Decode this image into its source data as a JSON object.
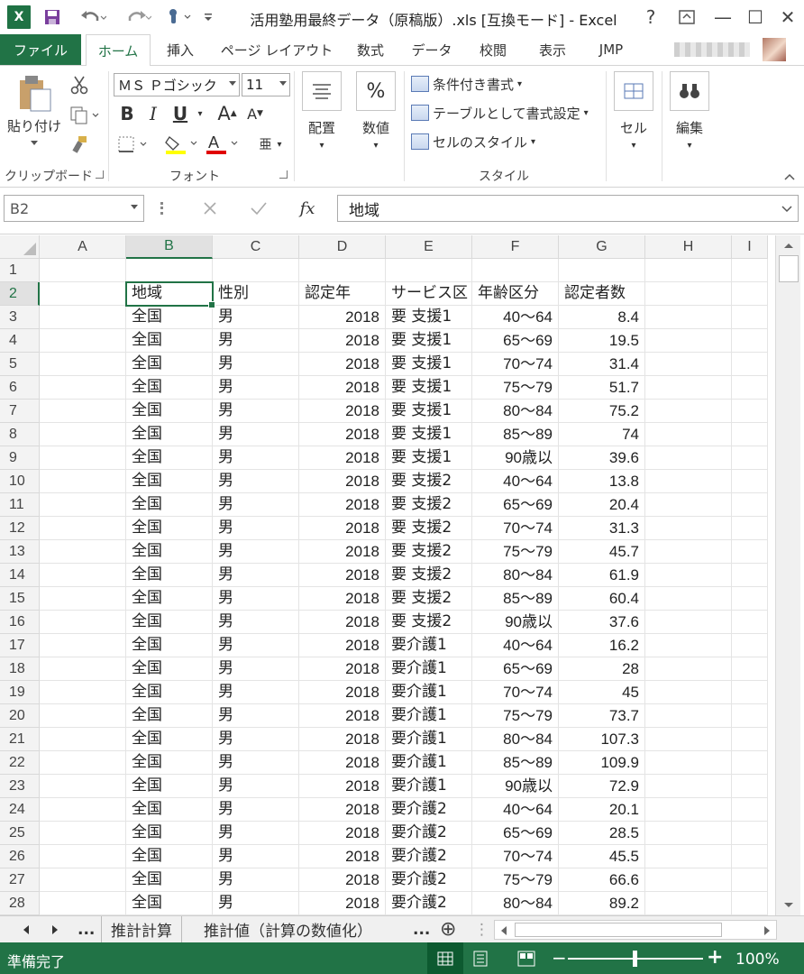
{
  "window": {
    "title": "活用塾用最終データ（原稿版）.xls  [互換モード] - Excel",
    "logo_text": "X",
    "help": "?",
    "controls": {
      "minimize": "—",
      "maximize": "☐",
      "close": "✕"
    }
  },
  "qat": {
    "save": "💾",
    "undo": "↶",
    "redo": "↷",
    "touch": "☝"
  },
  "tabs": {
    "file": "ファイル",
    "home": "ホーム",
    "insert": "挿入",
    "page_layout": "ページ レイアウト",
    "formulas": "数式",
    "data": "データ",
    "review": "校閲",
    "view": "表示",
    "jmp": "JMP"
  },
  "ribbon": {
    "clipboard": {
      "paste": "貼り付け",
      "label": "クリップボード"
    },
    "font": {
      "name": "ＭＳ Ｐゴシック",
      "size": "11",
      "bold": "B",
      "italic": "I",
      "underline": "U",
      "grow": "A",
      "shrink": "A",
      "label": "フォント",
      "furigana": "亜"
    },
    "alignment": {
      "label": "配置"
    },
    "number": {
      "label": "数値",
      "icon": "%"
    },
    "styles": {
      "conditional": "条件付き書式",
      "table": "テーブルとして書式設定",
      "cell_styles": "セルのスタイル",
      "label": "スタイル"
    },
    "cells": {
      "label": "セル"
    },
    "editing": {
      "label": "編集"
    }
  },
  "formula_bar": {
    "name_box": "B2",
    "fx": "fx",
    "value": "地域"
  },
  "columns": [
    "A",
    "B",
    "C",
    "D",
    "E",
    "F",
    "G",
    "H",
    "I"
  ],
  "rows": [
    {
      "n": "1",
      "b": "",
      "c": "",
      "d": "",
      "e": "",
      "f": "",
      "g": ""
    },
    {
      "n": "2",
      "b": "地域",
      "c": "性別",
      "d": "認定年",
      "e": "サービス区",
      "f": "年齢区分",
      "g": "認定者数"
    },
    {
      "n": "3",
      "b": "全国",
      "c": "男",
      "d": "2018",
      "e": "要 支援1",
      "f": "40〜64",
      "g": "8.4"
    },
    {
      "n": "4",
      "b": "全国",
      "c": "男",
      "d": "2018",
      "e": "要 支援1",
      "f": "65〜69",
      "g": "19.5"
    },
    {
      "n": "5",
      "b": "全国",
      "c": "男",
      "d": "2018",
      "e": "要 支援1",
      "f": "70〜74",
      "g": "31.4"
    },
    {
      "n": "6",
      "b": "全国",
      "c": "男",
      "d": "2018",
      "e": "要 支援1",
      "f": "75〜79",
      "g": "51.7"
    },
    {
      "n": "7",
      "b": "全国",
      "c": "男",
      "d": "2018",
      "e": "要 支援1",
      "f": "80〜84",
      "g": "75.2"
    },
    {
      "n": "8",
      "b": "全国",
      "c": "男",
      "d": "2018",
      "e": "要 支援1",
      "f": "85〜89",
      "g": "74"
    },
    {
      "n": "9",
      "b": "全国",
      "c": "男",
      "d": "2018",
      "e": "要 支援1",
      "f": "90歳以",
      "g": "39.6"
    },
    {
      "n": "10",
      "b": "全国",
      "c": "男",
      "d": "2018",
      "e": "要 支援2",
      "f": "40〜64",
      "g": "13.8"
    },
    {
      "n": "11",
      "b": "全国",
      "c": "男",
      "d": "2018",
      "e": "要 支援2",
      "f": "65〜69",
      "g": "20.4"
    },
    {
      "n": "12",
      "b": "全国",
      "c": "男",
      "d": "2018",
      "e": "要 支援2",
      "f": "70〜74",
      "g": "31.3"
    },
    {
      "n": "13",
      "b": "全国",
      "c": "男",
      "d": "2018",
      "e": "要 支援2",
      "f": "75〜79",
      "g": "45.7"
    },
    {
      "n": "14",
      "b": "全国",
      "c": "男",
      "d": "2018",
      "e": "要 支援2",
      "f": "80〜84",
      "g": "61.9"
    },
    {
      "n": "15",
      "b": "全国",
      "c": "男",
      "d": "2018",
      "e": "要 支援2",
      "f": "85〜89",
      "g": "60.4"
    },
    {
      "n": "16",
      "b": "全国",
      "c": "男",
      "d": "2018",
      "e": "要 支援2",
      "f": "90歳以",
      "g": "37.6"
    },
    {
      "n": "17",
      "b": "全国",
      "c": "男",
      "d": "2018",
      "e": "要介護1",
      "f": "40〜64",
      "g": "16.2"
    },
    {
      "n": "18",
      "b": "全国",
      "c": "男",
      "d": "2018",
      "e": "要介護1",
      "f": "65〜69",
      "g": "28"
    },
    {
      "n": "19",
      "b": "全国",
      "c": "男",
      "d": "2018",
      "e": "要介護1",
      "f": "70〜74",
      "g": "45"
    },
    {
      "n": "20",
      "b": "全国",
      "c": "男",
      "d": "2018",
      "e": "要介護1",
      "f": "75〜79",
      "g": "73.7"
    },
    {
      "n": "21",
      "b": "全国",
      "c": "男",
      "d": "2018",
      "e": "要介護1",
      "f": "80〜84",
      "g": "107.3"
    },
    {
      "n": "22",
      "b": "全国",
      "c": "男",
      "d": "2018",
      "e": "要介護1",
      "f": "85〜89",
      "g": "109.9"
    },
    {
      "n": "23",
      "b": "全国",
      "c": "男",
      "d": "2018",
      "e": "要介護1",
      "f": "90歳以",
      "g": "72.9"
    },
    {
      "n": "24",
      "b": "全国",
      "c": "男",
      "d": "2018",
      "e": "要介護2",
      "f": "40〜64",
      "g": "20.1"
    },
    {
      "n": "25",
      "b": "全国",
      "c": "男",
      "d": "2018",
      "e": "要介護2",
      "f": "65〜69",
      "g": "28.5"
    },
    {
      "n": "26",
      "b": "全国",
      "c": "男",
      "d": "2018",
      "e": "要介護2",
      "f": "70〜74",
      "g": "45.5"
    },
    {
      "n": "27",
      "b": "全国",
      "c": "男",
      "d": "2018",
      "e": "要介護2",
      "f": "75〜79",
      "g": "66.6"
    },
    {
      "n": "28",
      "b": "全国",
      "c": "男",
      "d": "2018",
      "e": "要介護2",
      "f": "80〜84",
      "g": "89.2"
    }
  ],
  "sheet_tabs": {
    "ellipsis_left": "...",
    "tab1": "推計計算",
    "tab2": "推計値（計算の数値化）",
    "ellipsis_right": "...",
    "add": "⊕"
  },
  "status": {
    "ready": "準備完了",
    "zoom": "100%",
    "minus": "−",
    "plus": "+"
  },
  "colors": {
    "accent": "#217346"
  }
}
